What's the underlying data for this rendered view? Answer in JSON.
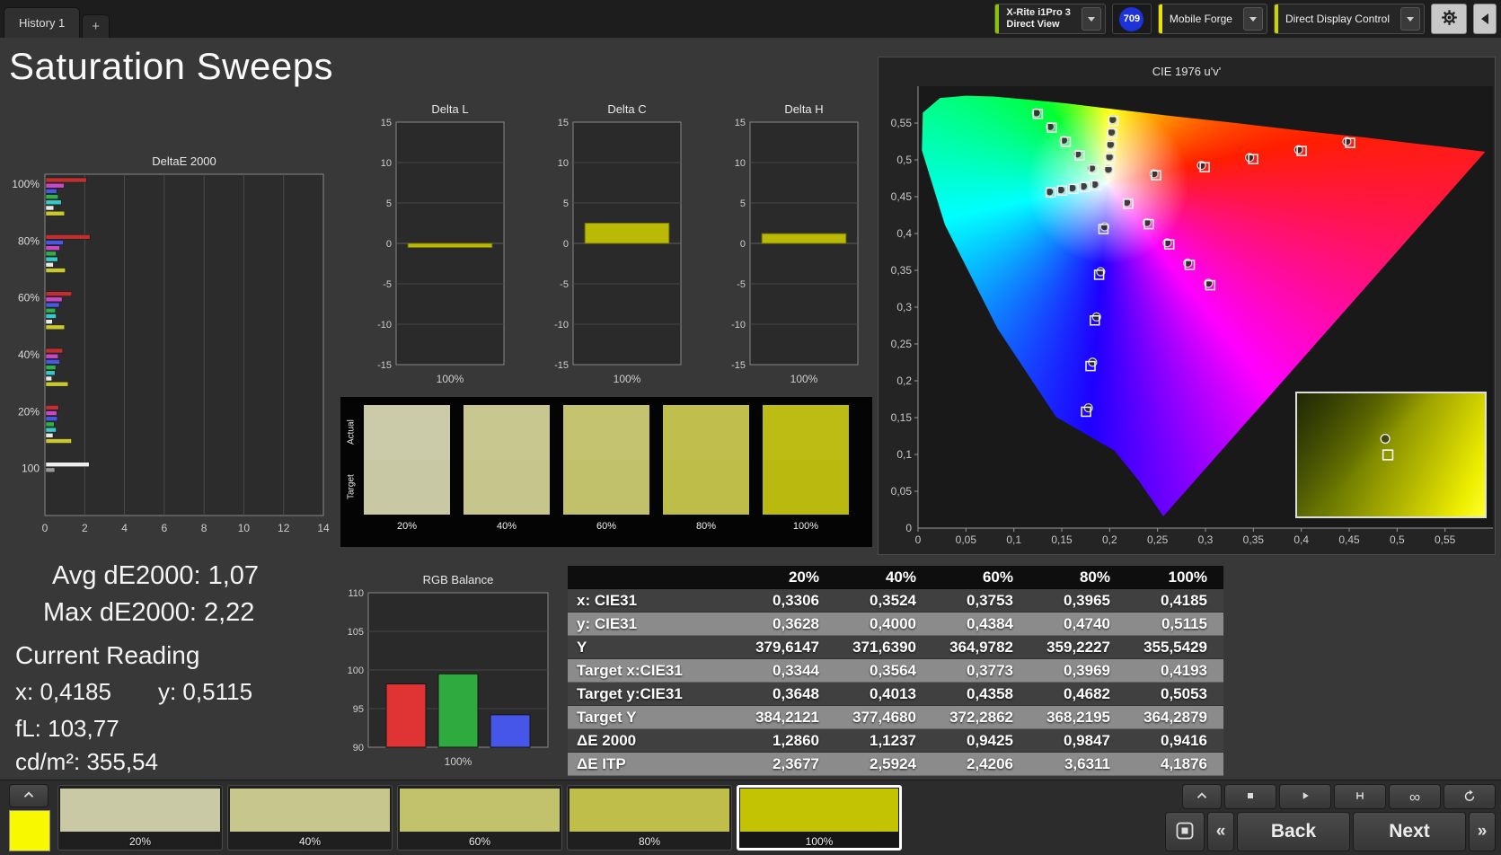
{
  "window": {
    "tab_title": "History 1",
    "add_tab": "+",
    "meter": {
      "line1": "X-Rite i1Pro 3",
      "line2": "Direct View"
    },
    "badge": "709",
    "source": "Mobile Forge",
    "display_control": "Direct Display Control",
    "accent_colors": {
      "meter": "#8bc400",
      "source": "#e8e400",
      "display": "#cbd400"
    }
  },
  "page_title": "Saturation Sweeps",
  "stats": {
    "avg": "Avg dE2000: 1,07",
    "max": "Max dE2000: 2,22",
    "current_reading": "Current Reading",
    "x": "x: 0,4185",
    "y": "y: 0,5115",
    "fl": "fL: 103,77",
    "cd": "cd/m²: 355,54"
  },
  "table": {
    "header": [
      "20%",
      "40%",
      "60%",
      "80%",
      "100%"
    ],
    "rows": [
      {
        "label": "x: CIE31",
        "values": [
          "0,3306",
          "0,3524",
          "0,3753",
          "0,3965",
          "0,4185"
        ]
      },
      {
        "label": "y: CIE31",
        "values": [
          "0,3628",
          "0,4000",
          "0,4384",
          "0,4740",
          "0,5115"
        ]
      },
      {
        "label": "Y",
        "values": [
          "379,6147",
          "371,6390",
          "364,9782",
          "359,2227",
          "355,5429"
        ]
      },
      {
        "label": "Target x:CIE31",
        "values": [
          "0,3344",
          "0,3564",
          "0,3773",
          "0,3969",
          "0,4193"
        ]
      },
      {
        "label": "Target y:CIE31",
        "values": [
          "0,3648",
          "0,4013",
          "0,4358",
          "0,4682",
          "0,5053"
        ]
      },
      {
        "label": "Target Y",
        "values": [
          "384,2121",
          "377,4680",
          "372,2862",
          "368,2195",
          "364,2879"
        ]
      },
      {
        "label": "ΔE 2000",
        "values": [
          "1,2860",
          "1,1237",
          "0,9425",
          "0,9847",
          "0,9416"
        ]
      },
      {
        "label": "ΔE ITP",
        "values": [
          "2,3677",
          "2,5924",
          "2,4206",
          "3,6311",
          "4,1876"
        ]
      }
    ]
  },
  "swatches": {
    "row_labels": [
      "Actual",
      "Target"
    ],
    "items": [
      {
        "label": "20%",
        "actual": "#cbcaa9",
        "target": "#c9c8a5"
      },
      {
        "label": "40%",
        "actual": "#c8c78f",
        "target": "#c6c58b"
      },
      {
        "label": "60%",
        "actual": "#c4c36f",
        "target": "#c2c16b"
      },
      {
        "label": "80%",
        "actual": "#c0bf4d",
        "target": "#bebd49"
      },
      {
        "label": "100%",
        "actual": "#bdbc15",
        "target": "#bab90f"
      }
    ]
  },
  "bottom": {
    "current_color": "#f8f800",
    "back": "Back",
    "next": "Next",
    "patches": [
      {
        "label": "20%",
        "color": "#cac9a6",
        "selected": false
      },
      {
        "label": "40%",
        "color": "#c7c68c",
        "selected": false
      },
      {
        "label": "60%",
        "color": "#c3c26c",
        "selected": false
      },
      {
        "label": "80%",
        "color": "#bfbe4a",
        "selected": false
      },
      {
        "label": "100%",
        "color": "#c3c303",
        "selected": true
      }
    ]
  },
  "chart_data": [
    {
      "id": "deltae2000",
      "type": "bar",
      "orientation": "horizontal",
      "title": "DeltaE 2000",
      "xlim": [
        0,
        14
      ],
      "xticks": [
        "0",
        "2",
        "4",
        "6",
        "8",
        "10",
        "12",
        "14"
      ],
      "groups": [
        {
          "label": "100%",
          "bars": [
            {
              "color": "#c03030",
              "value": 2.05
            },
            {
              "color": "#c848c8",
              "value": 0.92
            },
            {
              "color": "#4858e0",
              "value": 0.55
            },
            {
              "color": "#30b048",
              "value": 0.62
            },
            {
              "color": "#38c8c8",
              "value": 0.78
            },
            {
              "color": "#e8e8e8",
              "value": 0.4
            },
            {
              "color": "#c8c830",
              "value": 0.94
            }
          ]
        },
        {
          "label": "80%",
          "bars": [
            {
              "color": "#c03030",
              "value": 2.22
            },
            {
              "color": "#4858e0",
              "value": 0.88
            },
            {
              "color": "#c848c8",
              "value": 0.7
            },
            {
              "color": "#30b048",
              "value": 0.52
            },
            {
              "color": "#38c8c8",
              "value": 0.6
            },
            {
              "color": "#e8e8e8",
              "value": 0.38
            },
            {
              "color": "#c8c830",
              "value": 0.98
            }
          ]
        },
        {
          "label": "60%",
          "bars": [
            {
              "color": "#c03030",
              "value": 1.3
            },
            {
              "color": "#c848c8",
              "value": 0.82
            },
            {
              "color": "#4858e0",
              "value": 0.68
            },
            {
              "color": "#30b048",
              "value": 0.48
            },
            {
              "color": "#38c8c8",
              "value": 0.52
            },
            {
              "color": "#e8e8e8",
              "value": 0.33
            },
            {
              "color": "#c8c830",
              "value": 0.94
            }
          ]
        },
        {
          "label": "40%",
          "bars": [
            {
              "color": "#c03030",
              "value": 0.85
            },
            {
              "color": "#c848c8",
              "value": 0.62
            },
            {
              "color": "#4858e0",
              "value": 0.7
            },
            {
              "color": "#30b048",
              "value": 0.5
            },
            {
              "color": "#38c8c8",
              "value": 0.46
            },
            {
              "color": "#e8e8e8",
              "value": 0.3
            },
            {
              "color": "#c8c830",
              "value": 1.12
            }
          ]
        },
        {
          "label": "20%",
          "bars": [
            {
              "color": "#c03030",
              "value": 0.64
            },
            {
              "color": "#c848c8",
              "value": 0.55
            },
            {
              "color": "#4858e0",
              "value": 0.58
            },
            {
              "color": "#30b048",
              "value": 0.42
            },
            {
              "color": "#38c8c8",
              "value": 0.52
            },
            {
              "color": "#e8e8e8",
              "value": 0.36
            },
            {
              "color": "#c8c830",
              "value": 1.29
            }
          ]
        },
        {
          "label": "100",
          "bars": [
            {
              "color": "#eeeeee",
              "value": 2.18
            },
            {
              "color": "#9a9a9a",
              "value": 0.45
            }
          ]
        }
      ]
    },
    {
      "id": "delta_l",
      "type": "bar",
      "title": "Delta L",
      "ylim": [
        -15,
        15
      ],
      "yticks": [
        "15",
        "10",
        "5",
        "0",
        "-5",
        "-10",
        "-15"
      ],
      "categories": [
        "100%"
      ],
      "values": [
        -0.5
      ],
      "bar_color": "#b9b906"
    },
    {
      "id": "delta_c",
      "type": "bar",
      "title": "Delta C",
      "ylim": [
        -15,
        15
      ],
      "yticks": [
        "15",
        "10",
        "5",
        "0",
        "-5",
        "-10",
        "-15"
      ],
      "categories": [
        "100%"
      ],
      "values": [
        2.5
      ],
      "bar_color": "#b9b906"
    },
    {
      "id": "delta_h",
      "type": "bar",
      "title": "Delta H",
      "ylim": [
        -15,
        15
      ],
      "yticks": [
        "15",
        "10",
        "5",
        "0",
        "-5",
        "-10",
        "-15"
      ],
      "categories": [
        "100%"
      ],
      "values": [
        1.2
      ],
      "bar_color": "#b9b906"
    },
    {
      "id": "rgb_balance",
      "type": "bar",
      "title": "RGB Balance",
      "ylim": [
        90,
        110
      ],
      "yticks": [
        "110",
        "105",
        "100",
        "95",
        "90"
      ],
      "categories": [
        "100%"
      ],
      "series": [
        {
          "name": "Red",
          "color": "#e03434",
          "value": 98.2
        },
        {
          "name": "Green",
          "color": "#2faa3e",
          "value": 99.5
        },
        {
          "name": "Blue",
          "color": "#4656e8",
          "value": 94.2
        }
      ]
    },
    {
      "id": "cie1976",
      "type": "scatter",
      "title": "CIE 1976 u'v'",
      "xlim": [
        0,
        0.6
      ],
      "ylim": [
        0,
        0.6
      ],
      "tick_step": 0.05,
      "ticks": [
        "0",
        "0,05",
        "0,1",
        "0,15",
        "0,2",
        "0,25",
        "0,3",
        "0,35",
        "0,4",
        "0,45",
        "0,5",
        "0,55"
      ],
      "white_point": [
        0.198,
        0.468
      ],
      "locus": [
        [
          0.256,
          0.016
        ],
        [
          0.23,
          0.065
        ],
        [
          0.205,
          0.105
        ],
        [
          0.144,
          0.151
        ],
        [
          0.083,
          0.271
        ],
        [
          0.028,
          0.412
        ],
        [
          0.004,
          0.513
        ],
        [
          0.005,
          0.564
        ],
        [
          0.023,
          0.584
        ],
        [
          0.05,
          0.587
        ],
        [
          0.079,
          0.586
        ],
        [
          0.113,
          0.582
        ],
        [
          0.153,
          0.577
        ],
        [
          0.203,
          0.569
        ],
        [
          0.262,
          0.56
        ],
        [
          0.332,
          0.55
        ],
        [
          0.404,
          0.539
        ],
        [
          0.469,
          0.53
        ],
        [
          0.52,
          0.522
        ],
        [
          0.56,
          0.516
        ],
        [
          0.592,
          0.511
        ]
      ],
      "targets": [
        [
          0.2486,
          0.479
        ],
        [
          0.2992,
          0.49
        ],
        [
          0.3498,
          0.501
        ],
        [
          0.4004,
          0.512
        ],
        [
          0.451,
          0.523
        ],
        [
          0.1834,
          0.4869
        ],
        [
          0.1688,
          0.5058
        ],
        [
          0.1542,
          0.5247
        ],
        [
          0.1396,
          0.5436
        ],
        [
          0.125,
          0.5625
        ],
        [
          0.1935,
          0.406
        ],
        [
          0.189,
          0.344
        ],
        [
          0.1845,
          0.282
        ],
        [
          0.18,
          0.22
        ],
        [
          0.1754,
          0.158
        ],
        [
          0.1861,
          0.4655
        ],
        [
          0.1742,
          0.4631
        ],
        [
          0.1623,
          0.4606
        ],
        [
          0.1504,
          0.4582
        ],
        [
          0.1385,
          0.4557
        ],
        [
          0.2194,
          0.4404
        ],
        [
          0.2408,
          0.4127
        ],
        [
          0.2622,
          0.3851
        ],
        [
          0.2836,
          0.3574
        ],
        [
          0.305,
          0.3298
        ],
        [
          0.1992,
          0.485
        ],
        [
          0.2004,
          0.502
        ],
        [
          0.2015,
          0.519
        ],
        [
          0.2027,
          0.536
        ],
        [
          0.2039,
          0.5529
        ]
      ],
      "measured": [
        [
          0.2462,
          0.4812
        ],
        [
          0.2958,
          0.4925
        ],
        [
          0.3461,
          0.5032
        ],
        [
          0.3972,
          0.5138
        ],
        [
          0.4476,
          0.5249
        ],
        [
          0.1812,
          0.4888
        ],
        [
          0.1665,
          0.5079
        ],
        [
          0.1521,
          0.5266
        ],
        [
          0.1379,
          0.5451
        ],
        [
          0.1236,
          0.5638
        ],
        [
          0.1948,
          0.4091
        ],
        [
          0.1906,
          0.3482
        ],
        [
          0.1863,
          0.2867
        ],
        [
          0.1822,
          0.2252
        ],
        [
          0.1778,
          0.1633
        ],
        [
          0.1843,
          0.4668
        ],
        [
          0.1726,
          0.4642
        ],
        [
          0.1609,
          0.4617
        ],
        [
          0.1491,
          0.4592
        ],
        [
          0.1373,
          0.4566
        ],
        [
          0.2178,
          0.4422
        ],
        [
          0.2389,
          0.4148
        ],
        [
          0.2601,
          0.3874
        ],
        [
          0.2815,
          0.3599
        ],
        [
          0.3031,
          0.3324
        ],
        [
          0.1986,
          0.4872
        ],
        [
          0.1997,
          0.5041
        ],
        [
          0.2008,
          0.5209
        ],
        [
          0.2019,
          0.5376
        ],
        [
          0.2031,
          0.5547
        ]
      ]
    }
  ]
}
